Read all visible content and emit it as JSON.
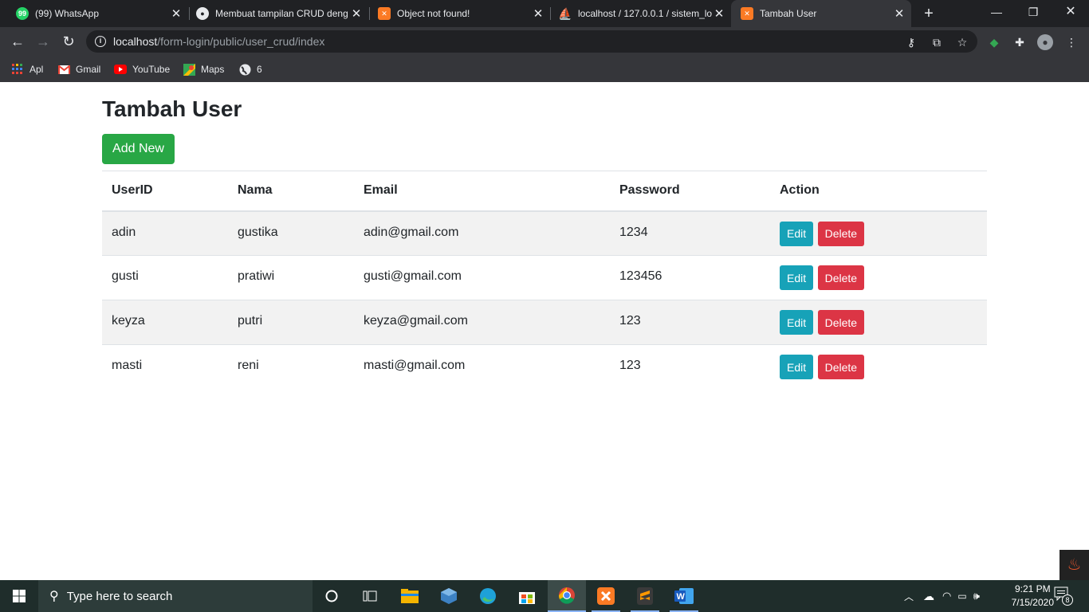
{
  "browser": {
    "tabs": [
      {
        "title": "(99) WhatsApp",
        "icon": "whatsapp-icon",
        "fav_color": "#25d366",
        "fav_text": "99"
      },
      {
        "title": "Membuat tampilan CRUD deng",
        "icon": "github-icon",
        "fav_color": "#202124",
        "fav_text": ""
      },
      {
        "title": "Object not found!",
        "icon": "xampp-icon",
        "fav_color": "#fb7a24",
        "fav_text": ""
      },
      {
        "title": "localhost / 127.0.0.1 / sistem_lo",
        "icon": "phpmyadmin-icon",
        "fav_color": "#f89c0e",
        "fav_text": ""
      },
      {
        "title": "Tambah User",
        "icon": "xampp-icon",
        "fav_color": "#fb7a24",
        "fav_text": ""
      }
    ],
    "url_host": "localhost",
    "url_path": "/form-login/public/user_crud/index",
    "bookmarks": [
      {
        "label": "Apl",
        "icon": "apps-grid-icon"
      },
      {
        "label": "Gmail",
        "icon": "gmail-icon"
      },
      {
        "label": "YouTube",
        "icon": "youtube-icon"
      },
      {
        "label": "Maps",
        "icon": "maps-icon"
      },
      {
        "label": "6",
        "icon": "globe-icon"
      }
    ]
  },
  "page": {
    "title": "Tambah User",
    "add_button": "Add New",
    "table": {
      "headers": [
        "UserID",
        "Nama",
        "Email",
        "Password",
        "Action"
      ],
      "rows": [
        {
          "userid": "adin",
          "nama": "gustika",
          "email": "adin@gmail.com",
          "password": "1234"
        },
        {
          "userid": "gusti",
          "nama": "pratiwi",
          "email": "gusti@gmail.com",
          "password": "123456"
        },
        {
          "userid": "keyza",
          "nama": "putri",
          "email": "keyza@gmail.com",
          "password": "123"
        },
        {
          "userid": "masti",
          "nama": "reni",
          "email": "masti@gmail.com",
          "password": "123"
        }
      ],
      "edit_label": "Edit",
      "delete_label": "Delete"
    }
  },
  "taskbar": {
    "search_placeholder": "Type here to search",
    "time": "9:21 PM",
    "date": "7/15/2020",
    "notification_count": "8"
  },
  "colors": {
    "add_button": "#28a745",
    "edit_button": "#17a2b8",
    "delete_button": "#dc3545"
  }
}
